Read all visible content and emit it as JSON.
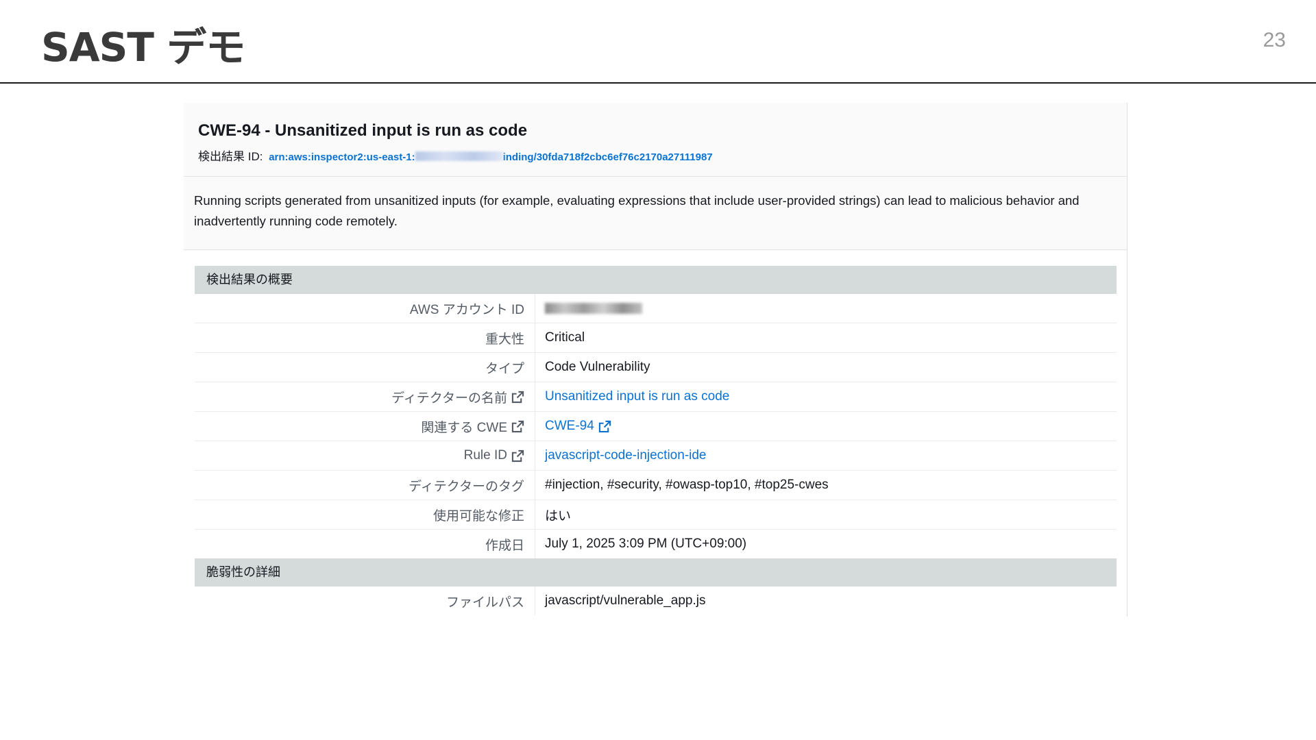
{
  "slide": {
    "title": "SAST デモ",
    "page_number": "23"
  },
  "finding": {
    "title": "CWE-94 - Unsanitized input is run as code",
    "id_label": "検出結果 ID:",
    "arn_prefix": "arn:aws:inspector2:us-east-1:",
    "arn_suffix": "inding/30fda718f2cbc6ef76c2170a27111987",
    "description": "Running scripts generated from unsanitized inputs (for example, evaluating expressions that include user-provided strings) can lead to malicious behavior and inadvertently running code remotely."
  },
  "overview": {
    "section_title": "検出結果の概要",
    "rows": [
      {
        "key": "AWS アカウント ID",
        "value": ""
      },
      {
        "key": "重大性",
        "value": "Critical"
      },
      {
        "key": "タイプ",
        "value": "Code Vulnerability"
      },
      {
        "key": "ディテクターの名前",
        "value": "Unsanitized input is run as code"
      },
      {
        "key": "関連する CWE",
        "value": "CWE-94"
      },
      {
        "key": "Rule ID",
        "value": "javascript-code-injection-ide"
      },
      {
        "key": "ディテクターのタグ",
        "value": "#injection, #security, #owasp-top10, #top25-cwes"
      },
      {
        "key": "使用可能な修正",
        "value": "はい"
      },
      {
        "key": "作成日",
        "value": "July 1, 2025 3:09 PM (UTC+09:00)"
      }
    ]
  },
  "vulnerability": {
    "section_title": "脆弱性の詳細",
    "rows": [
      {
        "key": "ファイルパス",
        "value": "javascript/vulnerable_app.js"
      }
    ]
  },
  "icons": {
    "external_link": "external-link-icon"
  },
  "colors": {
    "link": "#0972d3",
    "section_header_bg": "#d5dbdb"
  }
}
